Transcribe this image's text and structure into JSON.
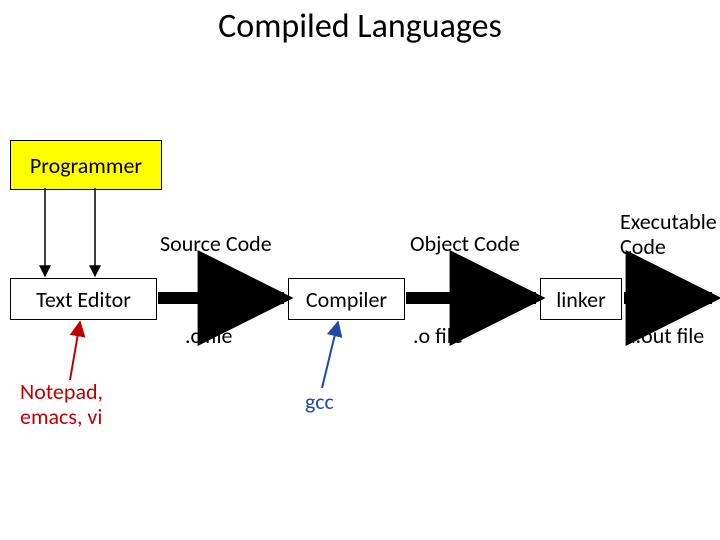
{
  "title": "Compiled Languages",
  "boxes": {
    "programmer": "Programmer",
    "text_editor": "Text Editor",
    "compiler": "Compiler",
    "linker": "linker"
  },
  "flow_labels": {
    "source_code": "Source Code",
    "object_code": "Object Code",
    "executable_code": "Executable\nCode"
  },
  "file_labels": {
    "c_file": ".c file",
    "o_file": ".o file",
    "aout_file": "a.out file"
  },
  "examples": {
    "editors": "Notepad,\nemacs, vi",
    "compiler": "gcc"
  }
}
